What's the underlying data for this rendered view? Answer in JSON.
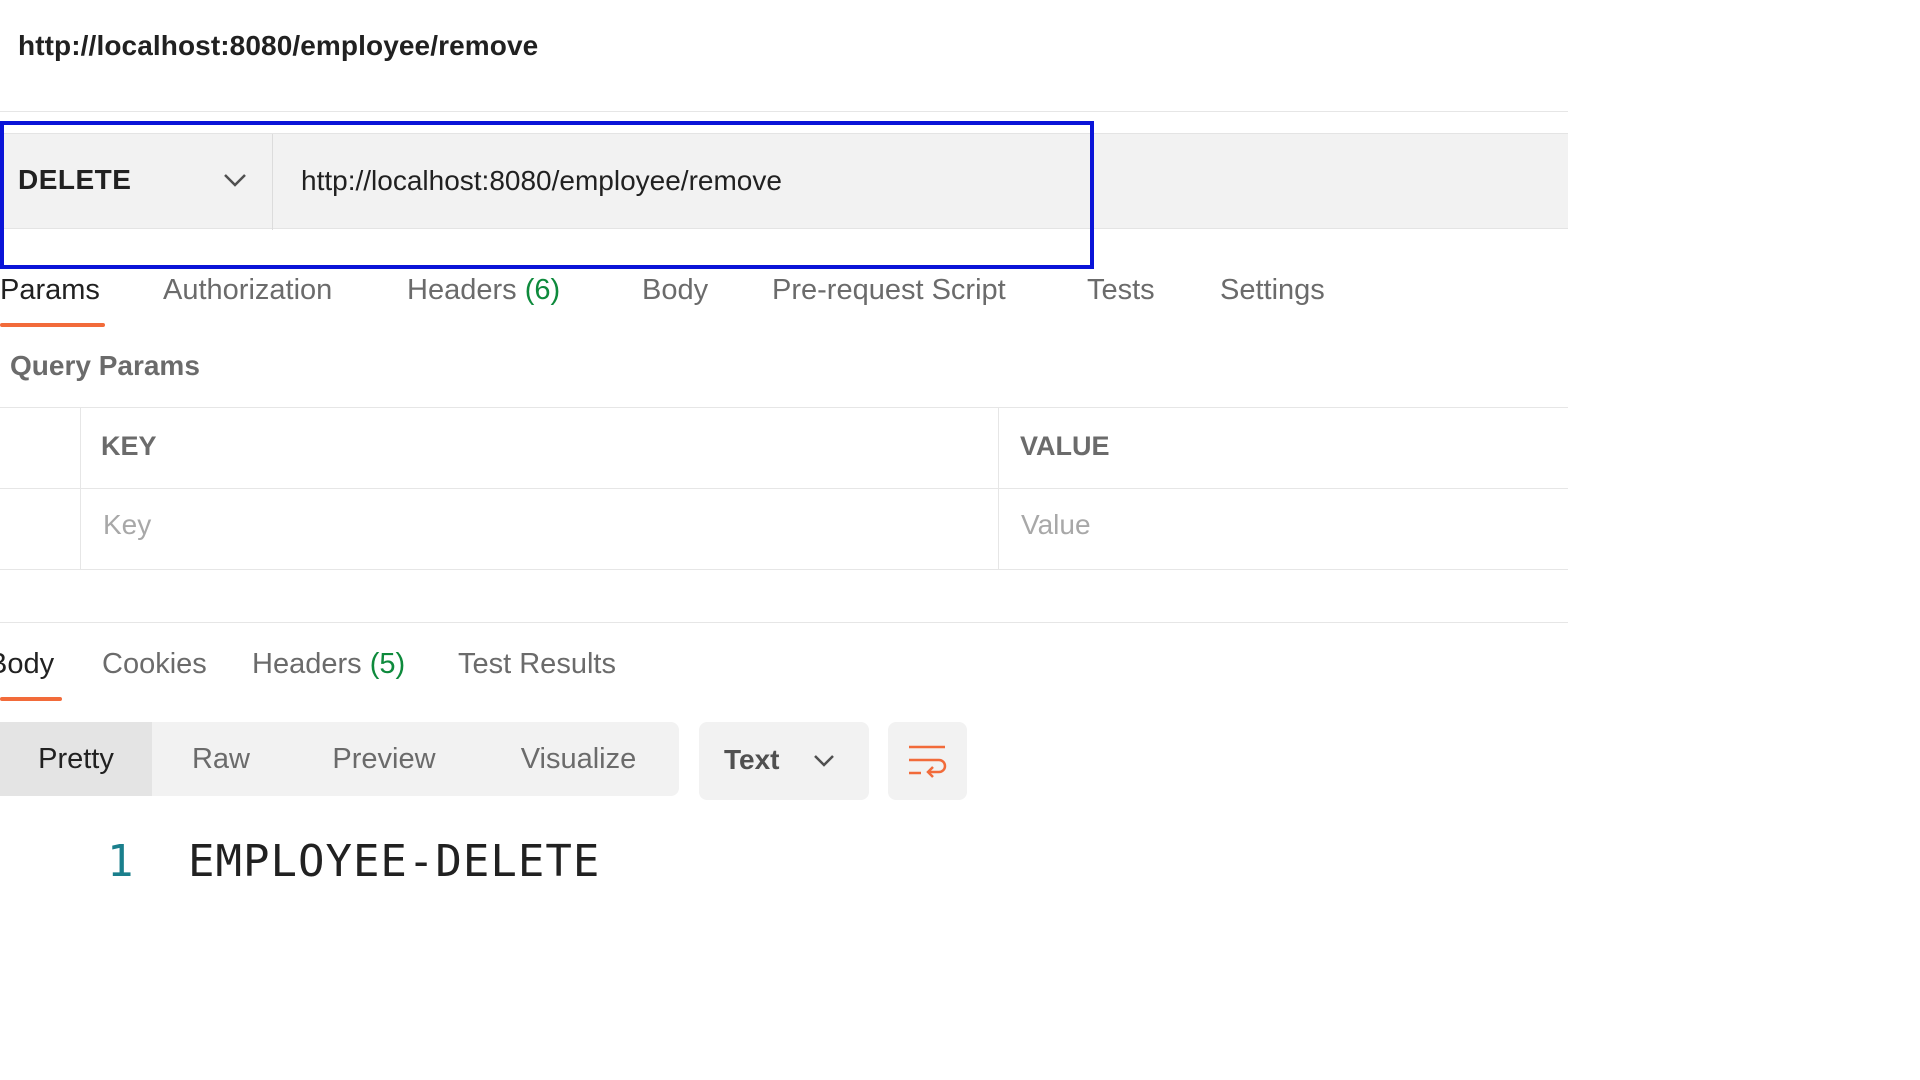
{
  "request": {
    "title": "http://localhost:8080/employee/remove",
    "method": "DELETE",
    "url": "http://localhost:8080/employee/remove"
  },
  "request_tabs": [
    {
      "label": "Params",
      "count": "",
      "active": true
    },
    {
      "label": "Authorization",
      "count": "",
      "active": false
    },
    {
      "label": "Headers",
      "count": "(6)",
      "active": false
    },
    {
      "label": "Body",
      "count": "",
      "active": false
    },
    {
      "label": "Pre-request Script",
      "count": "",
      "active": false
    },
    {
      "label": "Tests",
      "count": "",
      "active": false
    },
    {
      "label": "Settings",
      "count": "",
      "active": false
    }
  ],
  "query_params": {
    "title": "Query Params",
    "columns": [
      "KEY",
      "VALUE"
    ],
    "key_placeholder": "Key",
    "value_placeholder": "Value"
  },
  "response_tabs": [
    {
      "label": "Body",
      "count": "",
      "active": true
    },
    {
      "label": "Cookies",
      "count": "",
      "active": false
    },
    {
      "label": "Headers",
      "count": "(5)",
      "active": false
    },
    {
      "label": "Test Results",
      "count": "",
      "active": false
    }
  ],
  "view_modes": [
    {
      "label": "Pretty",
      "active": true
    },
    {
      "label": "Raw",
      "active": false
    },
    {
      "label": "Preview",
      "active": false
    },
    {
      "label": "Visualize",
      "active": false
    }
  ],
  "format": {
    "selected": "Text"
  },
  "response_body": {
    "line_number": "1",
    "content": "EMPLOYEE-DELETE"
  },
  "colors": {
    "accent": "#f26b3a",
    "count": "#0e8a3c",
    "highlight": "#0a14d8",
    "line_number": "#1a7f8c"
  },
  "icons": {
    "method_dropdown": "chevron-down-icon",
    "format_dropdown": "chevron-down-icon",
    "wrap": "wrap-lines-icon"
  }
}
